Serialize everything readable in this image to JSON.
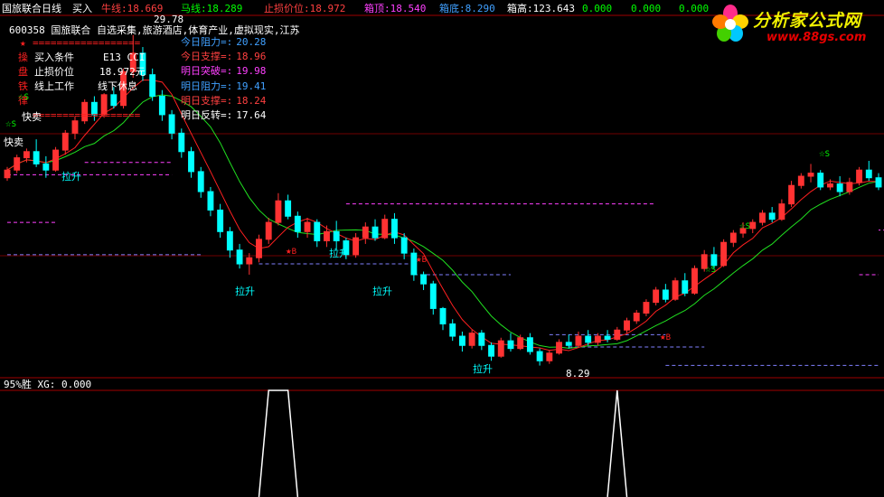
{
  "header": {
    "title": "国旅联合日线",
    "items": [
      {
        "label": "买入",
        "value": "",
        "color": "#ffffff"
      },
      {
        "label": "牛线:",
        "value": "18.669",
        "color": "#ff4040"
      },
      {
        "label": "马线:",
        "value": "18.289",
        "color": "#00ff00"
      },
      {
        "label": "止损价位:",
        "value": "18.972",
        "color": "#ff4040"
      },
      {
        "label": "箱顶:",
        "value": "18.540",
        "color": "#ff40ff"
      },
      {
        "label": "箱底:",
        "value": "8.290",
        "color": "#40a0ff"
      },
      {
        "label": "箱高:",
        "value": "123.643",
        "color": "#ffffff"
      },
      {
        "label": "",
        "value": "0.000",
        "color": "#00ff00"
      },
      {
        "label": "",
        "value": "0.000",
        "color": "#00ff00"
      },
      {
        "label": "",
        "value": "0.000",
        "color": "#00ff00"
      }
    ]
  },
  "logo": {
    "text": "分析家公式网",
    "url": "www.88gs.com"
  },
  "info": {
    "stock": "600358 国旅联合",
    "tags": "自选采集,旅游酒店,体育产业,虚拟现实,江苏",
    "separator": "==================",
    "left_labels": [
      "操",
      "盘",
      "铁",
      "律"
    ],
    "buy_condition": "买入条件",
    "indicator": "E13 CCI",
    "stop_label": "止损价位",
    "stop_value": "18.972元",
    "line_up": "线上工作",
    "line_down": "线下休息"
  },
  "levels": [
    {
      "label": "今日阻力=:",
      "value": "20.28",
      "color": "#40a0ff"
    },
    {
      "label": "今日支撑=:",
      "value": "18.96",
      "color": "#ff4040"
    },
    {
      "label": "明日突破=:",
      "value": "19.98",
      "color": "#ff40ff"
    },
    {
      "label": "明日阻力=:",
      "value": "19.41",
      "color": "#40a0ff"
    },
    {
      "label": "明日支撑=:",
      "value": "18.24",
      "color": "#ff4040"
    },
    {
      "label": "明日反转=:",
      "value": "17.64",
      "color": "#ffffff"
    }
  ],
  "annotations": {
    "high": "29.78",
    "low": "8.29",
    "pull_up": "拉升",
    "fast_sell": "快卖",
    "buy_mark": "B",
    "sell_mark": "S"
  },
  "lower_panel": {
    "title": "95%胜",
    "xg_label": "XG:",
    "xg_value": "0.000"
  },
  "chart_data": {
    "type": "candlestick",
    "y_range": [
      7.5,
      31.0
    ],
    "grid": "horizontal",
    "up_color": "#ff3232",
    "down_color": "#00ffff",
    "ma_fast_color": "#ff2020",
    "ma_slow_color": "#20e020",
    "candles": [
      {
        "o": 20.5,
        "h": 21.2,
        "c": 21.0,
        "l": 20.3
      },
      {
        "o": 21.0,
        "h": 22.0,
        "c": 21.8,
        "l": 20.8
      },
      {
        "o": 21.8,
        "h": 22.4,
        "c": 22.2,
        "l": 21.5
      },
      {
        "o": 22.2,
        "h": 23.0,
        "c": 21.4,
        "l": 21.2
      },
      {
        "o": 21.4,
        "h": 21.9,
        "c": 21.0,
        "l": 20.5
      },
      {
        "o": 21.0,
        "h": 22.5,
        "c": 22.3,
        "l": 20.9
      },
      {
        "o": 22.3,
        "h": 23.6,
        "c": 23.4,
        "l": 22.0
      },
      {
        "o": 23.4,
        "h": 24.5,
        "c": 24.2,
        "l": 23.0
      },
      {
        "o": 24.2,
        "h": 25.6,
        "c": 25.4,
        "l": 24.0
      },
      {
        "o": 25.4,
        "h": 25.8,
        "c": 24.6,
        "l": 24.2
      },
      {
        "o": 24.6,
        "h": 26.0,
        "c": 25.9,
        "l": 24.4
      },
      {
        "o": 25.9,
        "h": 26.4,
        "c": 25.2,
        "l": 25.0
      },
      {
        "o": 25.2,
        "h": 27.6,
        "c": 27.4,
        "l": 25.0
      },
      {
        "o": 27.4,
        "h": 29.78,
        "c": 28.6,
        "l": 27.0
      },
      {
        "o": 28.6,
        "h": 29.0,
        "c": 27.2,
        "l": 26.8
      },
      {
        "o": 27.2,
        "h": 27.6,
        "c": 25.8,
        "l": 25.5
      },
      {
        "o": 25.8,
        "h": 26.2,
        "c": 24.6,
        "l": 24.2
      },
      {
        "o": 24.6,
        "h": 24.9,
        "c": 23.4,
        "l": 23.0
      },
      {
        "o": 23.4,
        "h": 23.7,
        "c": 22.2,
        "l": 21.8
      },
      {
        "o": 22.2,
        "h": 22.5,
        "c": 20.9,
        "l": 20.5
      },
      {
        "o": 20.9,
        "h": 21.2,
        "c": 19.6,
        "l": 19.2
      },
      {
        "o": 19.6,
        "h": 19.9,
        "c": 18.4,
        "l": 18.0
      },
      {
        "o": 18.4,
        "h": 18.8,
        "c": 17.0,
        "l": 16.6
      },
      {
        "o": 17.0,
        "h": 17.3,
        "c": 15.8,
        "l": 15.3
      },
      {
        "o": 15.8,
        "h": 16.2,
        "c": 14.9,
        "l": 14.6
      },
      {
        "o": 14.9,
        "h": 15.6,
        "c": 15.3,
        "l": 14.2
      },
      {
        "o": 15.3,
        "h": 16.8,
        "c": 16.5,
        "l": 15.0
      },
      {
        "o": 16.5,
        "h": 17.9,
        "c": 17.6,
        "l": 16.2
      },
      {
        "o": 17.6,
        "h": 19.5,
        "c": 19.0,
        "l": 17.4
      },
      {
        "o": 19.0,
        "h": 19.4,
        "c": 18.0,
        "l": 17.8
      },
      {
        "o": 18.0,
        "h": 18.3,
        "c": 17.0,
        "l": 16.6
      },
      {
        "o": 17.0,
        "h": 17.9,
        "c": 17.6,
        "l": 16.6
      },
      {
        "o": 17.6,
        "h": 17.8,
        "c": 16.4,
        "l": 16.0
      },
      {
        "o": 16.4,
        "h": 17.4,
        "c": 17.0,
        "l": 16.0
      },
      {
        "o": 17.0,
        "h": 17.7,
        "c": 16.4,
        "l": 15.8
      },
      {
        "o": 16.4,
        "h": 16.6,
        "c": 15.5,
        "l": 15.2
      },
      {
        "o": 15.5,
        "h": 16.9,
        "c": 16.6,
        "l": 15.3
      },
      {
        "o": 16.6,
        "h": 17.6,
        "c": 17.3,
        "l": 16.2
      },
      {
        "o": 17.3,
        "h": 17.8,
        "c": 16.6,
        "l": 16.4
      },
      {
        "o": 16.6,
        "h": 18.1,
        "c": 17.8,
        "l": 16.5
      },
      {
        "o": 17.8,
        "h": 18.2,
        "c": 16.6,
        "l": 16.2
      },
      {
        "o": 16.6,
        "h": 16.9,
        "c": 15.6,
        "l": 15.2
      },
      {
        "o": 15.6,
        "h": 15.9,
        "c": 14.2,
        "l": 13.8
      },
      {
        "o": 14.2,
        "h": 14.4,
        "c": 13.6,
        "l": 13.2
      },
      {
        "o": 13.6,
        "h": 13.8,
        "c": 12.0,
        "l": 11.6
      },
      {
        "o": 12.0,
        "h": 12.1,
        "c": 11.0,
        "l": 10.6
      },
      {
        "o": 11.0,
        "h": 11.3,
        "c": 10.2,
        "l": 9.9
      },
      {
        "o": 10.2,
        "h": 10.5,
        "c": 9.6,
        "l": 9.2
      },
      {
        "o": 9.6,
        "h": 10.6,
        "c": 10.4,
        "l": 9.4
      },
      {
        "o": 10.4,
        "h": 10.6,
        "c": 9.6,
        "l": 9.3
      },
      {
        "o": 9.6,
        "h": 9.8,
        "c": 8.9,
        "l": 8.6
      },
      {
        "o": 8.9,
        "h": 10.1,
        "c": 9.9,
        "l": 8.8
      },
      {
        "o": 9.9,
        "h": 10.4,
        "c": 9.4,
        "l": 9.2
      },
      {
        "o": 9.4,
        "h": 10.3,
        "c": 10.1,
        "l": 9.3
      },
      {
        "o": 10.1,
        "h": 10.4,
        "c": 9.2,
        "l": 9.0
      },
      {
        "o": 9.2,
        "h": 9.4,
        "c": 8.6,
        "l": 8.29
      },
      {
        "o": 8.6,
        "h": 9.3,
        "c": 9.1,
        "l": 8.4
      },
      {
        "o": 9.1,
        "h": 10.0,
        "c": 9.8,
        "l": 9.0
      },
      {
        "o": 9.8,
        "h": 10.3,
        "c": 9.6,
        "l": 9.4
      },
      {
        "o": 9.6,
        "h": 10.5,
        "c": 10.2,
        "l": 9.5
      },
      {
        "o": 10.2,
        "h": 10.6,
        "c": 9.8,
        "l": 9.6
      },
      {
        "o": 9.8,
        "h": 10.4,
        "c": 10.2,
        "l": 9.6
      },
      {
        "o": 10.2,
        "h": 10.6,
        "c": 10.0,
        "l": 9.8
      },
      {
        "o": 10.0,
        "h": 10.8,
        "c": 10.6,
        "l": 9.9
      },
      {
        "o": 10.6,
        "h": 11.4,
        "c": 11.2,
        "l": 10.4
      },
      {
        "o": 11.2,
        "h": 11.9,
        "c": 11.7,
        "l": 11.0
      },
      {
        "o": 11.7,
        "h": 12.6,
        "c": 12.4,
        "l": 11.5
      },
      {
        "o": 12.4,
        "h": 13.4,
        "c": 13.2,
        "l": 12.2
      },
      {
        "o": 13.2,
        "h": 13.6,
        "c": 12.6,
        "l": 12.4
      },
      {
        "o": 12.6,
        "h": 14.0,
        "c": 13.8,
        "l": 12.5
      },
      {
        "o": 13.8,
        "h": 14.3,
        "c": 13.0,
        "l": 12.8
      },
      {
        "o": 13.0,
        "h": 14.8,
        "c": 14.6,
        "l": 12.9
      },
      {
        "o": 14.6,
        "h": 15.8,
        "c": 15.5,
        "l": 14.4
      },
      {
        "o": 15.5,
        "h": 16.0,
        "c": 14.8,
        "l": 14.6
      },
      {
        "o": 14.8,
        "h": 16.5,
        "c": 16.3,
        "l": 14.7
      },
      {
        "o": 16.3,
        "h": 17.1,
        "c": 16.9,
        "l": 16.0
      },
      {
        "o": 16.9,
        "h": 17.6,
        "c": 17.2,
        "l": 16.6
      },
      {
        "o": 17.2,
        "h": 17.8,
        "c": 17.6,
        "l": 16.9
      },
      {
        "o": 17.6,
        "h": 18.4,
        "c": 18.2,
        "l": 17.4
      },
      {
        "o": 18.2,
        "h": 18.6,
        "c": 17.8,
        "l": 17.6
      },
      {
        "o": 17.8,
        "h": 19.1,
        "c": 18.8,
        "l": 17.7
      },
      {
        "o": 18.8,
        "h": 20.3,
        "c": 20.0,
        "l": 18.6
      },
      {
        "o": 20.0,
        "h": 20.8,
        "c": 20.6,
        "l": 19.8
      },
      {
        "o": 20.6,
        "h": 21.4,
        "c": 20.8,
        "l": 20.2
      },
      {
        "o": 20.8,
        "h": 21.0,
        "c": 19.9,
        "l": 19.7
      },
      {
        "o": 19.9,
        "h": 20.4,
        "c": 20.1,
        "l": 19.7
      },
      {
        "o": 20.1,
        "h": 20.6,
        "c": 19.6,
        "l": 19.3
      },
      {
        "o": 19.6,
        "h": 20.5,
        "c": 20.2,
        "l": 19.4
      },
      {
        "o": 20.2,
        "h": 21.2,
        "c": 21.0,
        "l": 20.0
      },
      {
        "o": 21.0,
        "h": 21.6,
        "c": 20.5,
        "l": 20.3
      },
      {
        "o": 20.5,
        "h": 20.8,
        "c": 19.9,
        "l": 19.7
      }
    ],
    "box_lines": [
      {
        "level": 20.7,
        "from": 0,
        "to": 17,
        "color": "#ff40ff"
      },
      {
        "level": 17.6,
        "from": 0,
        "to": 5,
        "color": "#ff40ff"
      },
      {
        "level": 15.5,
        "from": 0,
        "to": 20,
        "color": "#8080ff"
      },
      {
        "level": 21.5,
        "from": 8,
        "to": 17,
        "color": "#ff40ff"
      },
      {
        "level": 18.8,
        "from": 35,
        "to": 67,
        "color": "#ff40ff"
      },
      {
        "level": 14.9,
        "from": 26,
        "to": 42,
        "color": "#8080ff"
      },
      {
        "level": 14.2,
        "from": 42,
        "to": 52,
        "color": "#8080ff"
      },
      {
        "level": 9.5,
        "from": 58,
        "to": 72,
        "color": "#8080ff"
      },
      {
        "level": 10.3,
        "from": 56,
        "to": 68,
        "color": "#8080ff"
      },
      {
        "level": 8.3,
        "from": 68,
        "to": 112,
        "color": "#8080ff"
      },
      {
        "level": 14.2,
        "from": 88,
        "to": 98,
        "color": "#ff40ff"
      },
      {
        "level": 17.1,
        "from": 100,
        "to": 112,
        "color": "#ff40ff"
      }
    ],
    "signals_lower": [
      {
        "from": 26,
        "peak1": 27,
        "peak2": 29,
        "to": 30
      },
      {
        "from": 62,
        "peak1": 63,
        "peak2": 63,
        "to": 64
      }
    ]
  }
}
